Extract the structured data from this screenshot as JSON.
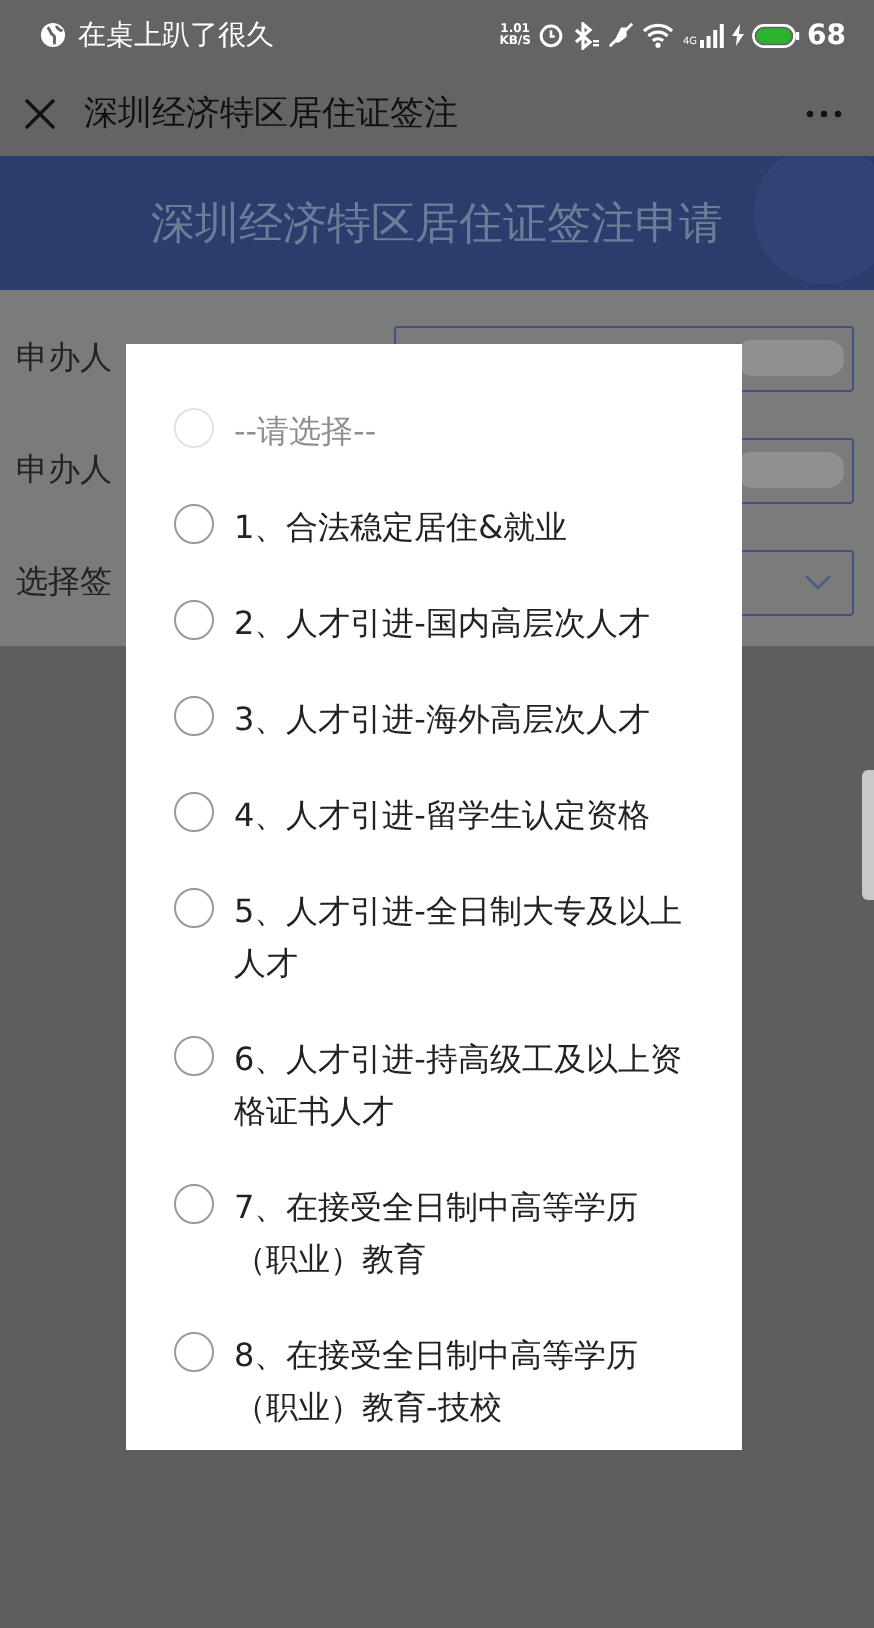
{
  "status_bar": {
    "notification": "在桌上趴了很久",
    "net_speed": "1.01",
    "net_speed_unit": "KB/S",
    "network_type": "4G",
    "battery": "68"
  },
  "nav": {
    "title": "深圳经济特区居住证签注"
  },
  "banner": {
    "title": "深圳经济特区居住证签注申请"
  },
  "form": {
    "rows": [
      {
        "label": "申办人",
        "kind": "text"
      },
      {
        "label": "申办人",
        "kind": "text"
      },
      {
        "label": "选择签",
        "kind": "select"
      }
    ]
  },
  "dialog": {
    "options": [
      {
        "label": "--请选择--",
        "selected": false,
        "disabled": true
      },
      {
        "label": "1、合法稳定居住&就业",
        "selected": false,
        "disabled": false
      },
      {
        "label": "2、人才引进-国内高层次人才",
        "selected": false,
        "disabled": false
      },
      {
        "label": "3、人才引进-海外高层次人才",
        "selected": false,
        "disabled": false
      },
      {
        "label": "4、人才引进-留学生认定资格",
        "selected": false,
        "disabled": false
      },
      {
        "label": "5、人才引进-全日制大专及以上人才",
        "selected": false,
        "disabled": false
      },
      {
        "label": "6、人才引进-持高级工及以上资格证书人才",
        "selected": false,
        "disabled": false
      },
      {
        "label": "7、在接受全日制中高等学历（职业）教育",
        "selected": false,
        "disabled": false
      },
      {
        "label": "8、在接受全日制中高等学历（职业）教育-技校",
        "selected": false,
        "disabled": false
      }
    ]
  }
}
